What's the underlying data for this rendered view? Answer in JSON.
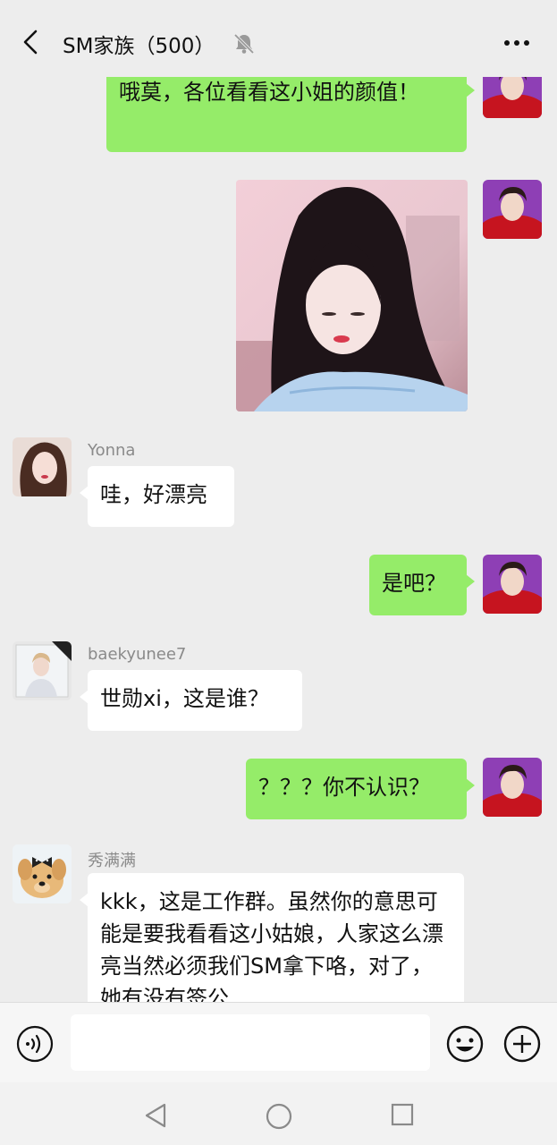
{
  "header": {
    "title": "SM家族（500）",
    "back_icon": "chevron-left-icon",
    "mute_icon": "bell-muted-icon",
    "more_icon": "more-dots-icon"
  },
  "messages": [
    {
      "id": "m1",
      "from": "me",
      "type": "text",
      "text": "哦莫，各位看看这小姐的颜值！"
    },
    {
      "id": "m2",
      "from": "me",
      "type": "image"
    },
    {
      "id": "m3",
      "from": "them",
      "sender": "Yonna",
      "type": "text",
      "text": "哇，好漂亮"
    },
    {
      "id": "m4",
      "from": "me",
      "type": "text",
      "text": "是吧？"
    },
    {
      "id": "m5",
      "from": "them",
      "sender": "baekyunee7",
      "type": "text",
      "text": "世勋xi，这是谁？"
    },
    {
      "id": "m6",
      "from": "me",
      "type": "text",
      "text": "？？？你不认识？"
    },
    {
      "id": "m7",
      "from": "them",
      "sender": "秀满满",
      "type": "text",
      "text": "kkk，这是工作群。虽然你的意思可能是要我看看这小姑娘，人家这么漂亮当然必须我们SM拿下咯，对了，她有没有签公"
    }
  ],
  "input": {
    "value": "",
    "voice_icon": "voice-icon",
    "emoji_icon": "emoji-icon",
    "plus_icon": "plus-icon"
  },
  "colors": {
    "my_bubble": "#95ec69",
    "their_bubble": "#ffffff",
    "background": "#ededed"
  }
}
